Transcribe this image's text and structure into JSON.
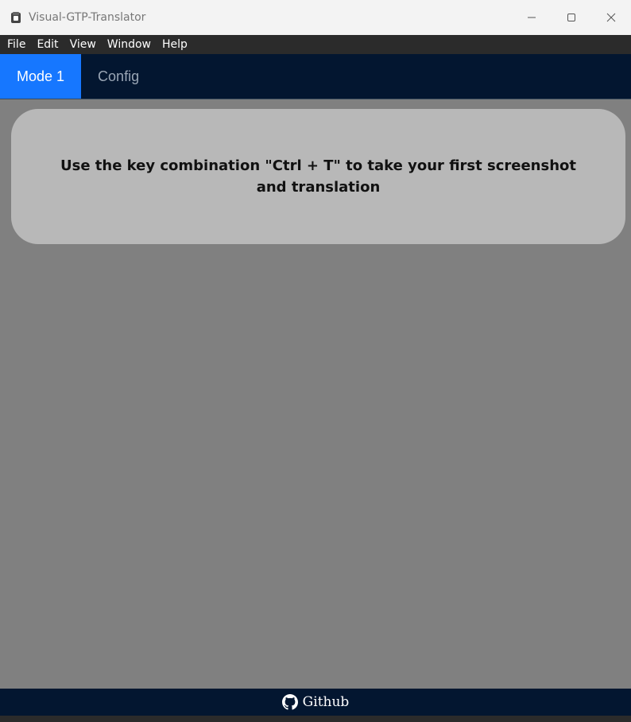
{
  "window": {
    "title": "Visual-GTP-Translator"
  },
  "menubar": {
    "items": [
      "File",
      "Edit",
      "View",
      "Window",
      "Help"
    ]
  },
  "tabs": [
    {
      "label": "Mode 1",
      "active": true
    },
    {
      "label": "Config",
      "active": false
    }
  ],
  "notice": {
    "text": "Use the key combination \"Ctrl + T\" to take your first screenshot and translation"
  },
  "footer": {
    "link_label": "Github",
    "icon": "github-icon"
  },
  "colors": {
    "accent": "#1677ff",
    "nav_bg": "#031630",
    "content_bg": "#808080",
    "card_bg": "#b8b8b8"
  }
}
